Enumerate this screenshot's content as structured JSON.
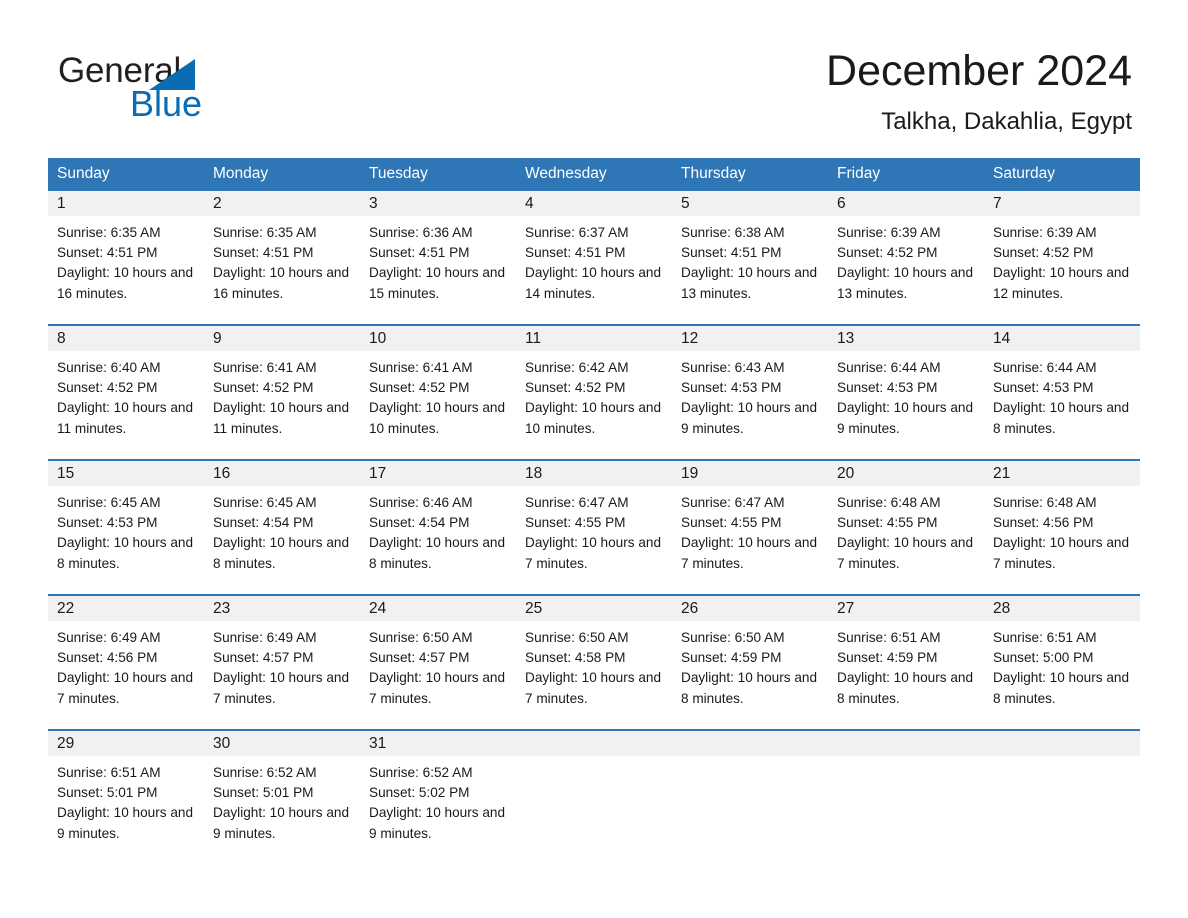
{
  "brand": {
    "name_part1": "General",
    "name_part2": "Blue",
    "accent_color": "#0b6cb3"
  },
  "header": {
    "title": "December 2024",
    "location": "Talkha, Dakahlia, Egypt"
  },
  "calendar": {
    "header_color": "#2e76b6",
    "weekday_headers": [
      "Sunday",
      "Monday",
      "Tuesday",
      "Wednesday",
      "Thursday",
      "Friday",
      "Saturday"
    ],
    "weeks": [
      [
        {
          "day": "1",
          "sunrise": "Sunrise: 6:35 AM",
          "sunset": "Sunset: 4:51 PM",
          "daylight": "Daylight: 10 hours and 16 minutes."
        },
        {
          "day": "2",
          "sunrise": "Sunrise: 6:35 AM",
          "sunset": "Sunset: 4:51 PM",
          "daylight": "Daylight: 10 hours and 16 minutes."
        },
        {
          "day": "3",
          "sunrise": "Sunrise: 6:36 AM",
          "sunset": "Sunset: 4:51 PM",
          "daylight": "Daylight: 10 hours and 15 minutes."
        },
        {
          "day": "4",
          "sunrise": "Sunrise: 6:37 AM",
          "sunset": "Sunset: 4:51 PM",
          "daylight": "Daylight: 10 hours and 14 minutes."
        },
        {
          "day": "5",
          "sunrise": "Sunrise: 6:38 AM",
          "sunset": "Sunset: 4:51 PM",
          "daylight": "Daylight: 10 hours and 13 minutes."
        },
        {
          "day": "6",
          "sunrise": "Sunrise: 6:39 AM",
          "sunset": "Sunset: 4:52 PM",
          "daylight": "Daylight: 10 hours and 13 minutes."
        },
        {
          "day": "7",
          "sunrise": "Sunrise: 6:39 AM",
          "sunset": "Sunset: 4:52 PM",
          "daylight": "Daylight: 10 hours and 12 minutes."
        }
      ],
      [
        {
          "day": "8",
          "sunrise": "Sunrise: 6:40 AM",
          "sunset": "Sunset: 4:52 PM",
          "daylight": "Daylight: 10 hours and 11 minutes."
        },
        {
          "day": "9",
          "sunrise": "Sunrise: 6:41 AM",
          "sunset": "Sunset: 4:52 PM",
          "daylight": "Daylight: 10 hours and 11 minutes."
        },
        {
          "day": "10",
          "sunrise": "Sunrise: 6:41 AM",
          "sunset": "Sunset: 4:52 PM",
          "daylight": "Daylight: 10 hours and 10 minutes."
        },
        {
          "day": "11",
          "sunrise": "Sunrise: 6:42 AM",
          "sunset": "Sunset: 4:52 PM",
          "daylight": "Daylight: 10 hours and 10 minutes."
        },
        {
          "day": "12",
          "sunrise": "Sunrise: 6:43 AM",
          "sunset": "Sunset: 4:53 PM",
          "daylight": "Daylight: 10 hours and 9 minutes."
        },
        {
          "day": "13",
          "sunrise": "Sunrise: 6:44 AM",
          "sunset": "Sunset: 4:53 PM",
          "daylight": "Daylight: 10 hours and 9 minutes."
        },
        {
          "day": "14",
          "sunrise": "Sunrise: 6:44 AM",
          "sunset": "Sunset: 4:53 PM",
          "daylight": "Daylight: 10 hours and 8 minutes."
        }
      ],
      [
        {
          "day": "15",
          "sunrise": "Sunrise: 6:45 AM",
          "sunset": "Sunset: 4:53 PM",
          "daylight": "Daylight: 10 hours and 8 minutes."
        },
        {
          "day": "16",
          "sunrise": "Sunrise: 6:45 AM",
          "sunset": "Sunset: 4:54 PM",
          "daylight": "Daylight: 10 hours and 8 minutes."
        },
        {
          "day": "17",
          "sunrise": "Sunrise: 6:46 AM",
          "sunset": "Sunset: 4:54 PM",
          "daylight": "Daylight: 10 hours and 8 minutes."
        },
        {
          "day": "18",
          "sunrise": "Sunrise: 6:47 AM",
          "sunset": "Sunset: 4:55 PM",
          "daylight": "Daylight: 10 hours and 7 minutes."
        },
        {
          "day": "19",
          "sunrise": "Sunrise: 6:47 AM",
          "sunset": "Sunset: 4:55 PM",
          "daylight": "Daylight: 10 hours and 7 minutes."
        },
        {
          "day": "20",
          "sunrise": "Sunrise: 6:48 AM",
          "sunset": "Sunset: 4:55 PM",
          "daylight": "Daylight: 10 hours and 7 minutes."
        },
        {
          "day": "21",
          "sunrise": "Sunrise: 6:48 AM",
          "sunset": "Sunset: 4:56 PM",
          "daylight": "Daylight: 10 hours and 7 minutes."
        }
      ],
      [
        {
          "day": "22",
          "sunrise": "Sunrise: 6:49 AM",
          "sunset": "Sunset: 4:56 PM",
          "daylight": "Daylight: 10 hours and 7 minutes."
        },
        {
          "day": "23",
          "sunrise": "Sunrise: 6:49 AM",
          "sunset": "Sunset: 4:57 PM",
          "daylight": "Daylight: 10 hours and 7 minutes."
        },
        {
          "day": "24",
          "sunrise": "Sunrise: 6:50 AM",
          "sunset": "Sunset: 4:57 PM",
          "daylight": "Daylight: 10 hours and 7 minutes."
        },
        {
          "day": "25",
          "sunrise": "Sunrise: 6:50 AM",
          "sunset": "Sunset: 4:58 PM",
          "daylight": "Daylight: 10 hours and 7 minutes."
        },
        {
          "day": "26",
          "sunrise": "Sunrise: 6:50 AM",
          "sunset": "Sunset: 4:59 PM",
          "daylight": "Daylight: 10 hours and 8 minutes."
        },
        {
          "day": "27",
          "sunrise": "Sunrise: 6:51 AM",
          "sunset": "Sunset: 4:59 PM",
          "daylight": "Daylight: 10 hours and 8 minutes."
        },
        {
          "day": "28",
          "sunrise": "Sunrise: 6:51 AM",
          "sunset": "Sunset: 5:00 PM",
          "daylight": "Daylight: 10 hours and 8 minutes."
        }
      ],
      [
        {
          "day": "29",
          "sunrise": "Sunrise: 6:51 AM",
          "sunset": "Sunset: 5:01 PM",
          "daylight": "Daylight: 10 hours and 9 minutes."
        },
        {
          "day": "30",
          "sunrise": "Sunrise: 6:52 AM",
          "sunset": "Sunset: 5:01 PM",
          "daylight": "Daylight: 10 hours and 9 minutes."
        },
        {
          "day": "31",
          "sunrise": "Sunrise: 6:52 AM",
          "sunset": "Sunset: 5:02 PM",
          "daylight": "Daylight: 10 hours and 9 minutes."
        },
        {
          "day": "",
          "sunrise": "",
          "sunset": "",
          "daylight": ""
        },
        {
          "day": "",
          "sunrise": "",
          "sunset": "",
          "daylight": ""
        },
        {
          "day": "",
          "sunrise": "",
          "sunset": "",
          "daylight": ""
        },
        {
          "day": "",
          "sunrise": "",
          "sunset": "",
          "daylight": ""
        }
      ]
    ]
  }
}
